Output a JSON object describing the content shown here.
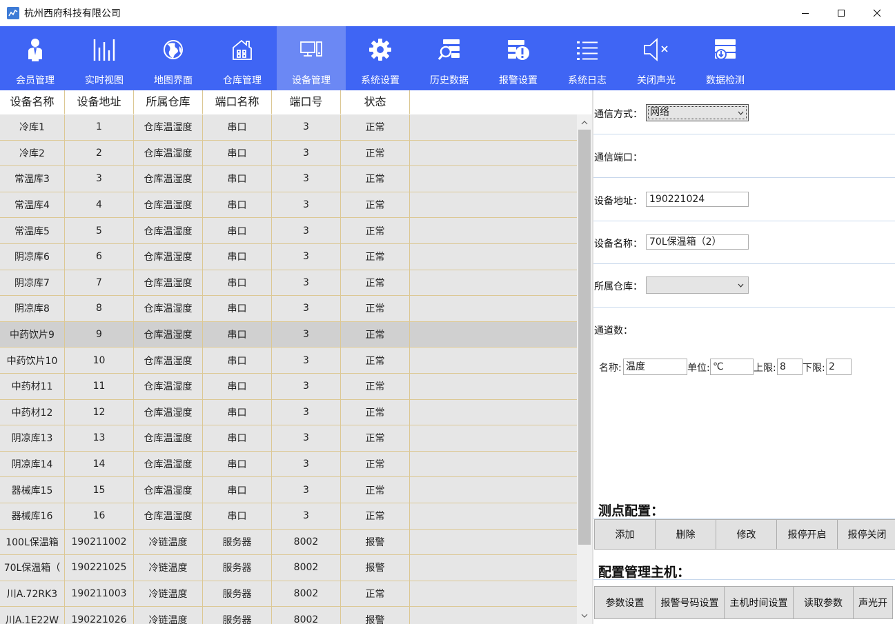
{
  "window": {
    "title": "杭州西府科技有限公司"
  },
  "toolbar": {
    "items": [
      {
        "label": "会员管理",
        "icon": "member-icon"
      },
      {
        "label": "实时视图",
        "icon": "realtime-chart-icon"
      },
      {
        "label": "地图界面",
        "icon": "globe-icon"
      },
      {
        "label": "仓库管理",
        "icon": "warehouse-icon"
      },
      {
        "label": "设备管理",
        "icon": "devices-icon"
      },
      {
        "label": "系统设置",
        "icon": "gear-icon"
      },
      {
        "label": "历史数据",
        "icon": "history-search-icon"
      },
      {
        "label": "报警设置",
        "icon": "alarm-settings-icon"
      },
      {
        "label": "系统日志",
        "icon": "list-icon"
      },
      {
        "label": "关闭声光",
        "icon": "mute-icon"
      },
      {
        "label": "数据检测",
        "icon": "database-icon"
      }
    ],
    "active_index": 4,
    "colors": {
      "background": "#3f65f4",
      "active": "#6b88f4"
    }
  },
  "table": {
    "columns": [
      "设备名称",
      "设备地址",
      "所属仓库",
      "端口名称",
      "端口号",
      "状态"
    ],
    "selected_row": 8,
    "rows": [
      [
        "冷库1",
        "1",
        "仓库温湿度",
        "串口",
        "3",
        "正常"
      ],
      [
        "冷库2",
        "2",
        "仓库温湿度",
        "串口",
        "3",
        "正常"
      ],
      [
        "常温库3",
        "3",
        "仓库温湿度",
        "串口",
        "3",
        "正常"
      ],
      [
        "常温库4",
        "4",
        "仓库温湿度",
        "串口",
        "3",
        "正常"
      ],
      [
        "常温库5",
        "5",
        "仓库温湿度",
        "串口",
        "3",
        "正常"
      ],
      [
        "阴凉库6",
        "6",
        "仓库温湿度",
        "串口",
        "3",
        "正常"
      ],
      [
        "阴凉库7",
        "7",
        "仓库温湿度",
        "串口",
        "3",
        "正常"
      ],
      [
        "阴凉库8",
        "8",
        "仓库温湿度",
        "串口",
        "3",
        "正常"
      ],
      [
        "中药饮片9",
        "9",
        "仓库温湿度",
        "串口",
        "3",
        "正常"
      ],
      [
        "中药饮片10",
        "10",
        "仓库温湿度",
        "串口",
        "3",
        "正常"
      ],
      [
        "中药材11",
        "11",
        "仓库温湿度",
        "串口",
        "3",
        "正常"
      ],
      [
        "中药材12",
        "12",
        "仓库温湿度",
        "串口",
        "3",
        "正常"
      ],
      [
        "阴凉库13",
        "13",
        "仓库温湿度",
        "串口",
        "3",
        "正常"
      ],
      [
        "阴凉库14",
        "14",
        "仓库温湿度",
        "串口",
        "3",
        "正常"
      ],
      [
        "器械库15",
        "15",
        "仓库温湿度",
        "串口",
        "3",
        "正常"
      ],
      [
        "器械库16",
        "16",
        "仓库温湿度",
        "串口",
        "3",
        "正常"
      ],
      [
        "100L保温箱",
        "190211002",
        "冷链温度",
        "服务器",
        "8002",
        "报警"
      ],
      [
        "70L保温箱（",
        "190221025",
        "冷链温度",
        "服务器",
        "8002",
        "报警"
      ],
      [
        "川A.72RK3",
        "190211003",
        "冷链温度",
        "服务器",
        "8002",
        "正常"
      ],
      [
        "川A.1E22W",
        "190221026",
        "冷链温度",
        "服务器",
        "8002",
        "报警"
      ]
    ]
  },
  "panel": {
    "comm_mode_label": "通信方式：",
    "comm_mode_value": "网络",
    "comm_port_label": "通信端口：",
    "device_addr_label": "设备地址：",
    "device_addr_value": "190221024",
    "device_name_label": "设备名称：",
    "device_name_value": "70L保温箱（2）",
    "warehouse_label": "所属仓库：",
    "warehouse_value": "",
    "channels_label": "通道数：",
    "measure": {
      "name_label": "名称:",
      "name_value": "温度",
      "unit_label": "单位:",
      "unit_value": "℃",
      "upper_label": "上限:",
      "upper_value": "8",
      "lower_label": "下限:",
      "lower_value": "2"
    },
    "point_config_title": "测点配置：",
    "point_buttons": [
      "添加",
      "删除",
      "修改",
      "报停开启",
      "报停关闭"
    ],
    "host_config_title": "配置管理主机：",
    "host_buttons": [
      "参数设置",
      "报警号码设置",
      "主机时间设置",
      "读取参数",
      "声光开"
    ]
  }
}
